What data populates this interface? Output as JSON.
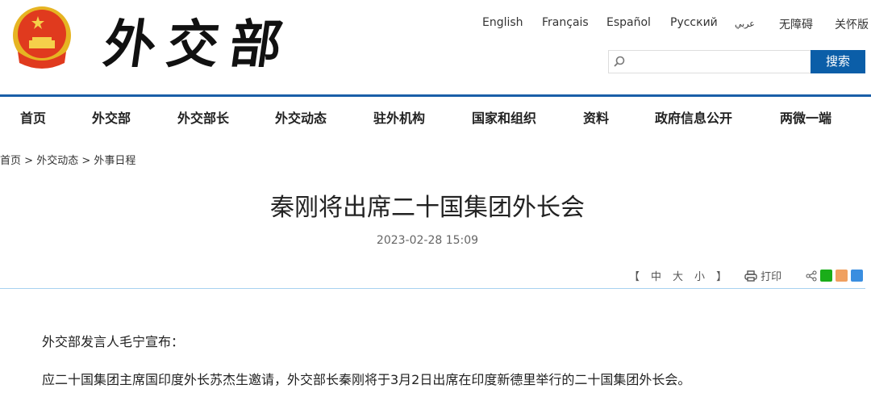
{
  "header": {
    "logo_text": "外交部",
    "languages": [
      "English",
      "Français",
      "Español",
      "Русский",
      "عربي",
      "无障碍",
      "关怀版"
    ],
    "search": {
      "placeholder": "",
      "button": "搜索"
    }
  },
  "nav": [
    "首页",
    "外交部",
    "外交部长",
    "外交动态",
    "驻外机构",
    "国家和组织",
    "资料",
    "政府信息公开",
    "两微一端"
  ],
  "breadcrumb": [
    "首页",
    ">",
    "外交动态",
    ">",
    "外事日程"
  ],
  "article": {
    "title": "秦刚将出席二十国集团外长会",
    "date": "2023-02-28 15:09",
    "font_size": {
      "open": "【",
      "mid": "中",
      "large": "大",
      "small": "小",
      "close": "】"
    },
    "print": "打印",
    "paragraphs": [
      "外交部发言人毛宁宣布：",
      "应二十国集团主席国印度外长苏杰生邀请，外交部长秦刚将于3月2日出席在印度新德里举行的二十国集团外长会。"
    ]
  },
  "colors": {
    "accent": "#0b5ea8",
    "divider": "#a8d2f0"
  }
}
